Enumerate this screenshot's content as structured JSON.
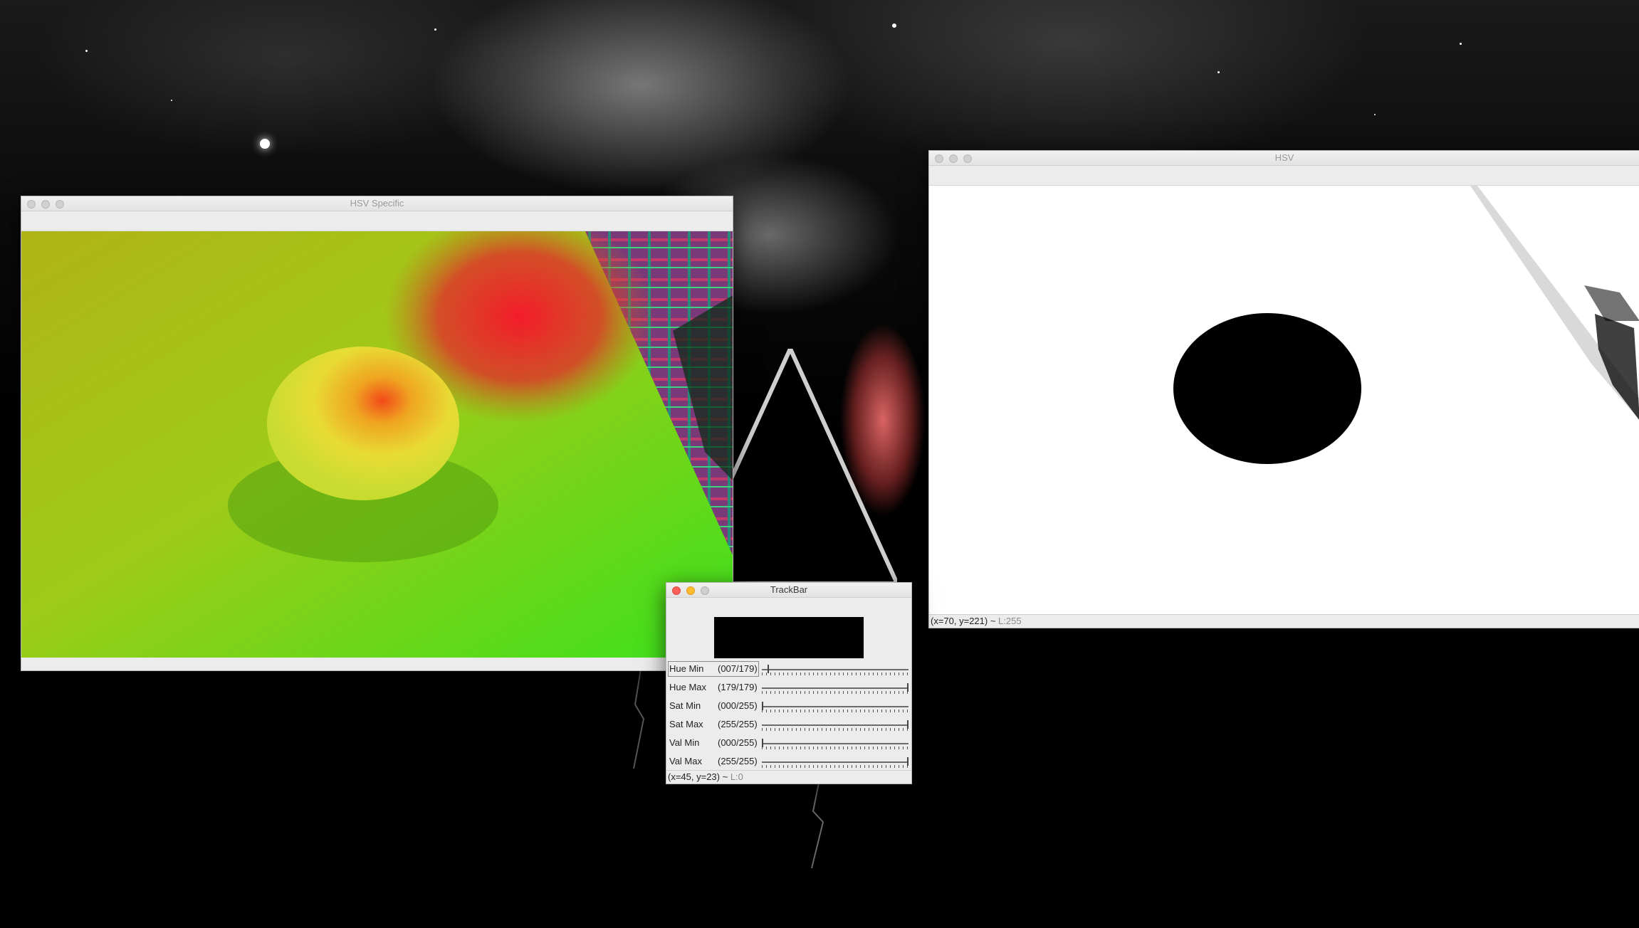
{
  "windows": {
    "hsv_specific": {
      "title": "HSV Specific"
    },
    "hsv": {
      "title": "HSV",
      "status_coords": "(x=70, y=221) ~",
      "status_level": "L:255"
    },
    "trackbar": {
      "title": "TrackBar",
      "status_coords": "(x=45, y=23) ~",
      "status_level": "L:0",
      "sliders": [
        {
          "label": "Hue Min",
          "value_text": "(007/179)",
          "value": 7,
          "max": 179
        },
        {
          "label": "Hue Max",
          "value_text": "(179/179)",
          "value": 179,
          "max": 179
        },
        {
          "label": "Sat Min",
          "value_text": "(000/255)",
          "value": 0,
          "max": 255
        },
        {
          "label": "Sat Max",
          "value_text": "(255/255)",
          "value": 255,
          "max": 255
        },
        {
          "label": "Val Min",
          "value_text": "(000/255)",
          "value": 0,
          "max": 255
        },
        {
          "label": "Val Max",
          "value_text": "(255/255)",
          "value": 255,
          "max": 255
        }
      ]
    }
  },
  "colors": {
    "close": "#fc5f57",
    "minimize": "#fdbc2e",
    "inactive_light": "#cfcfcf"
  },
  "icons": [
    "close-icon",
    "minimize-icon",
    "zoom-icon"
  ]
}
